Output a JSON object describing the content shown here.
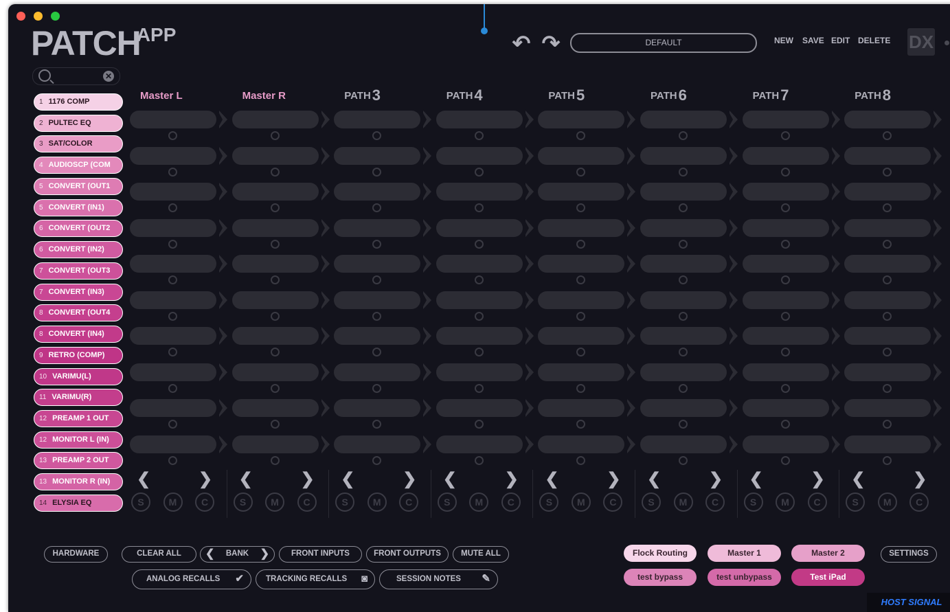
{
  "colors": {
    "window_bg": "#13131c",
    "slot": "#2c2c34",
    "accent_pink": "#c23a86",
    "cursor_blue": "#2a8ad8",
    "host_signal": "#2f7cff"
  },
  "title_bar": {
    "close_color": "#fe5f57",
    "minimize_color": "#febc2e",
    "zoom_color": "#28c840"
  },
  "logo": {
    "main": "PATCH",
    "sub": "APP"
  },
  "toolbar": {
    "undo_icon": "undo-arrow",
    "redo_icon": "redo-arrow",
    "preset": "DEFAULT",
    "new": "NEW",
    "save": "SAVE",
    "edit": "EDIT",
    "delete": "DELETE",
    "dx": "DX"
  },
  "search": {
    "icon": "magnifier-icon",
    "clear": "x"
  },
  "devices": [
    {
      "num": "1",
      "name": "1176 COMP",
      "color": "#f5d1e6",
      "text": "#2a1520"
    },
    {
      "num": "2",
      "name": "PULTEC EQ",
      "color": "#efb2d3",
      "text": "#2a1520"
    },
    {
      "num": "3",
      "name": "SAT/COLOR",
      "color": "#e99cc6",
      "text": "#2a1520"
    },
    {
      "num": "4",
      "name": "AUDIOSCP (COM",
      "color": "#e389bb",
      "text": "#ffffff"
    },
    {
      "num": "5",
      "name": "CONVERT (OUT1",
      "color": "#de7cb3",
      "text": "#ffffff"
    },
    {
      "num": "5",
      "name": "CONVERT (IN1)",
      "color": "#da71ad",
      "text": "#ffffff"
    },
    {
      "num": "6",
      "name": "CONVERT (OUT2",
      "color": "#d565a6",
      "text": "#ffffff"
    },
    {
      "num": "6",
      "name": "CONVERT (IN2)",
      "color": "#d15ba0",
      "text": "#ffffff"
    },
    {
      "num": "7",
      "name": "CONVERT (OUT3",
      "color": "#cd519a",
      "text": "#ffffff"
    },
    {
      "num": "7",
      "name": "CONVERT (IN3)",
      "color": "#c94794",
      "text": "#ffffff"
    },
    {
      "num": "8",
      "name": "CONVERT (OUT4",
      "color": "#c53f8e",
      "text": "#ffffff"
    },
    {
      "num": "8",
      "name": "CONVERT (IN4)",
      "color": "#c23a8a",
      "text": "#ffffff"
    },
    {
      "num": "9",
      "name": "RETRO (COMP)",
      "color": "#bf3587",
      "text": "#ffffff"
    },
    {
      "num": "10",
      "name": "VARIMU(L)",
      "color": "#c03889",
      "text": "#ffffff"
    },
    {
      "num": "11",
      "name": "VARIMU(R)",
      "color": "#c33e8c",
      "text": "#ffffff"
    },
    {
      "num": "12",
      "name": "PREAMP 1 OUT",
      "color": "#c84792",
      "text": "#ffffff"
    },
    {
      "num": "12",
      "name": "MONITOR L (IN)",
      "color": "#cc4f98",
      "text": "#ffffff"
    },
    {
      "num": "13",
      "name": "PREAMP 2 OUT",
      "color": "#d0589e",
      "text": "#ffffff"
    },
    {
      "num": "13",
      "name": "MONITOR R (IN)",
      "color": "#d463a5",
      "text": "#ffffff"
    },
    {
      "num": "14",
      "name": "ELYSIA EQ",
      "color": "#d86cab",
      "text": "#2a1520"
    }
  ],
  "paths": [
    {
      "label": "Master L",
      "num": "",
      "color": "#e79cc8"
    },
    {
      "label": "Master R",
      "num": "",
      "color": "#e79cc8"
    },
    {
      "label": "PATH",
      "num": "3",
      "color": "#aeaeb8"
    },
    {
      "label": "PATH",
      "num": "4",
      "color": "#aeaeb8"
    },
    {
      "label": "PATH",
      "num": "5",
      "color": "#aeaeb8"
    },
    {
      "label": "PATH",
      "num": "6",
      "color": "#aeaeb8"
    },
    {
      "label": "PATH",
      "num": "7",
      "color": "#aeaeb8"
    },
    {
      "label": "PATH",
      "num": "8",
      "color": "#aeaeb8"
    }
  ],
  "slot_rows": 10,
  "path_controls": {
    "prev": "❮",
    "next": "❯",
    "s": "S",
    "m": "M",
    "c": "C"
  },
  "bottom": {
    "hardware": "HARDWARE",
    "clear_all": "CLEAR ALL",
    "bank": "BANK",
    "bank_prev": "❮",
    "bank_next": "❯",
    "front_inputs": "FRONT INPUTS",
    "front_outputs": "FRONT OUTPUTS",
    "mute_all": "MUTE ALL",
    "analog_recalls": "ANALOG RECALLS",
    "tracking_recalls": "TRACKING RECALLS",
    "session_notes": "SESSION NOTES",
    "settings": "SETTINGS"
  },
  "presets": [
    {
      "label": "Flock Routing",
      "bg": "#f7d6ea",
      "fg": "#3a2430"
    },
    {
      "label": "Master 1",
      "bg": "#efbbd9",
      "fg": "#3a2430"
    },
    {
      "label": "Master 2",
      "bg": "#e6a0c9",
      "fg": "#3a2430"
    },
    {
      "label": "test bypass",
      "bg": "#dc84b8",
      "fg": "#3a2430"
    },
    {
      "label": "test unbypass",
      "bg": "#d46aa9",
      "fg": "#3a2430"
    },
    {
      "label": "Test iPad",
      "bg": "#c23a86",
      "fg": "#ffffff"
    }
  ],
  "status": {
    "host_signal": "HOST SIGNAL"
  }
}
